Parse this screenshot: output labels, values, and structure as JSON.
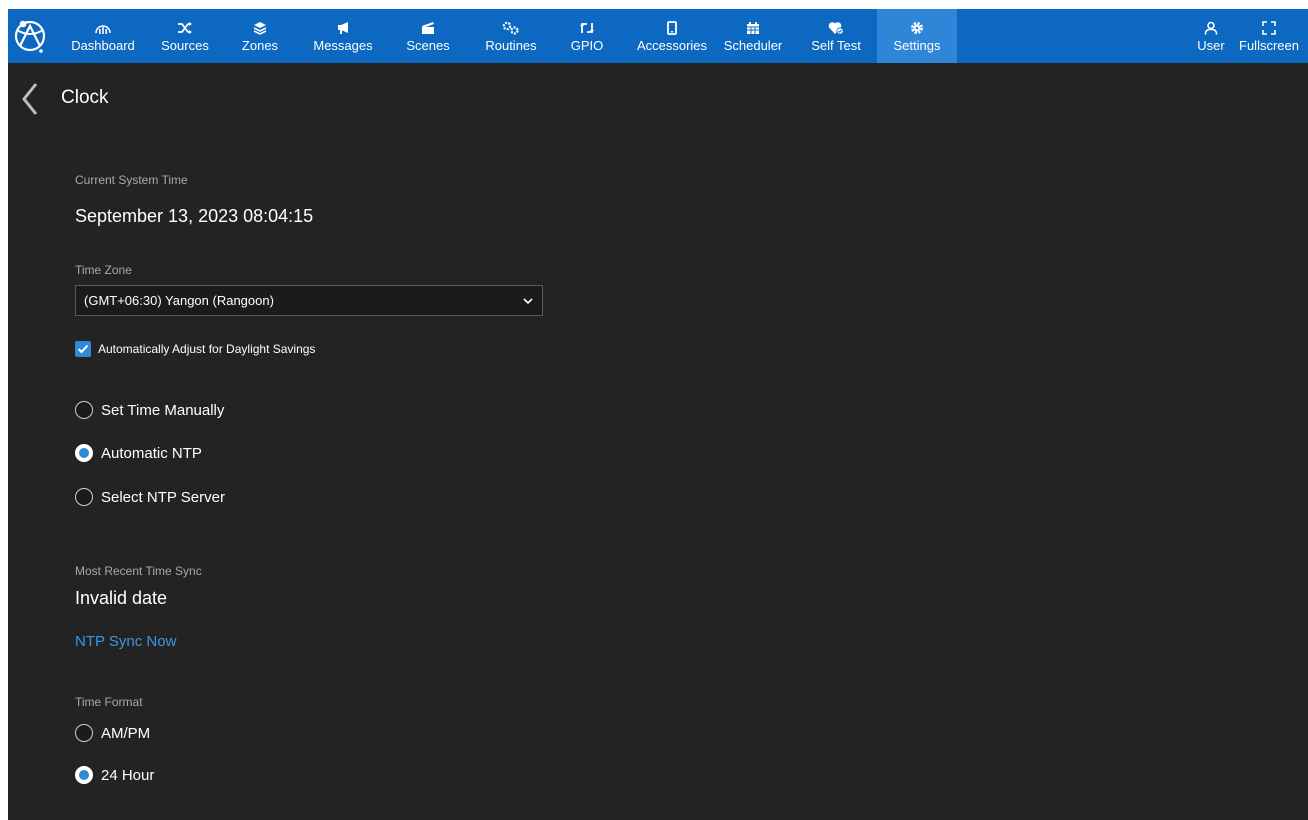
{
  "nav": {
    "items": [
      {
        "label": "Dashboard",
        "icon": "dashboard-icon"
      },
      {
        "label": "Sources",
        "icon": "shuffle-icon"
      },
      {
        "label": "Zones",
        "icon": "layers-icon"
      },
      {
        "label": "Messages",
        "icon": "megaphone-icon"
      },
      {
        "label": "Scenes",
        "icon": "clapperboard-icon"
      },
      {
        "label": "Routines",
        "icon": "gears-icon"
      },
      {
        "label": "GPIO",
        "icon": "swap-arrows-icon"
      },
      {
        "label": "Accessories",
        "icon": "tablet-icon"
      },
      {
        "label": "Scheduler",
        "icon": "calendar-icon"
      },
      {
        "label": "Self Test",
        "icon": "heart-check-icon"
      },
      {
        "label": "Settings",
        "icon": "gear-icon",
        "active": true
      }
    ],
    "right": [
      {
        "label": "User",
        "icon": "user-icon"
      },
      {
        "label": "Fullscreen",
        "icon": "fullscreen-icon"
      }
    ]
  },
  "page": {
    "title": "Clock"
  },
  "clock": {
    "current_label": "Current System Time",
    "current_value": "September 13, 2023 08:04:15",
    "timezone_label": "Time Zone",
    "timezone_value": "(GMT+06:30) Yangon (Rangoon)",
    "dst_label": "Automatically Adjust for Daylight Savings",
    "dst_checked": true,
    "mode_options": [
      "Set Time Manually",
      "Automatic NTP",
      "Select NTP Server"
    ],
    "mode_selected": "Automatic NTP",
    "sync_label": "Most Recent Time Sync",
    "sync_value": "Invalid date",
    "sync_link": "NTP Sync Now",
    "format_label": "Time Format",
    "format_options": [
      "AM/PM",
      "24 Hour"
    ],
    "format_selected": "24 Hour"
  },
  "colors": {
    "nav_bg": "#0c68c1",
    "nav_active": "#2f86d9",
    "bg": "#232323",
    "accent": "#2e8ad8",
    "link": "#3b97e3"
  }
}
